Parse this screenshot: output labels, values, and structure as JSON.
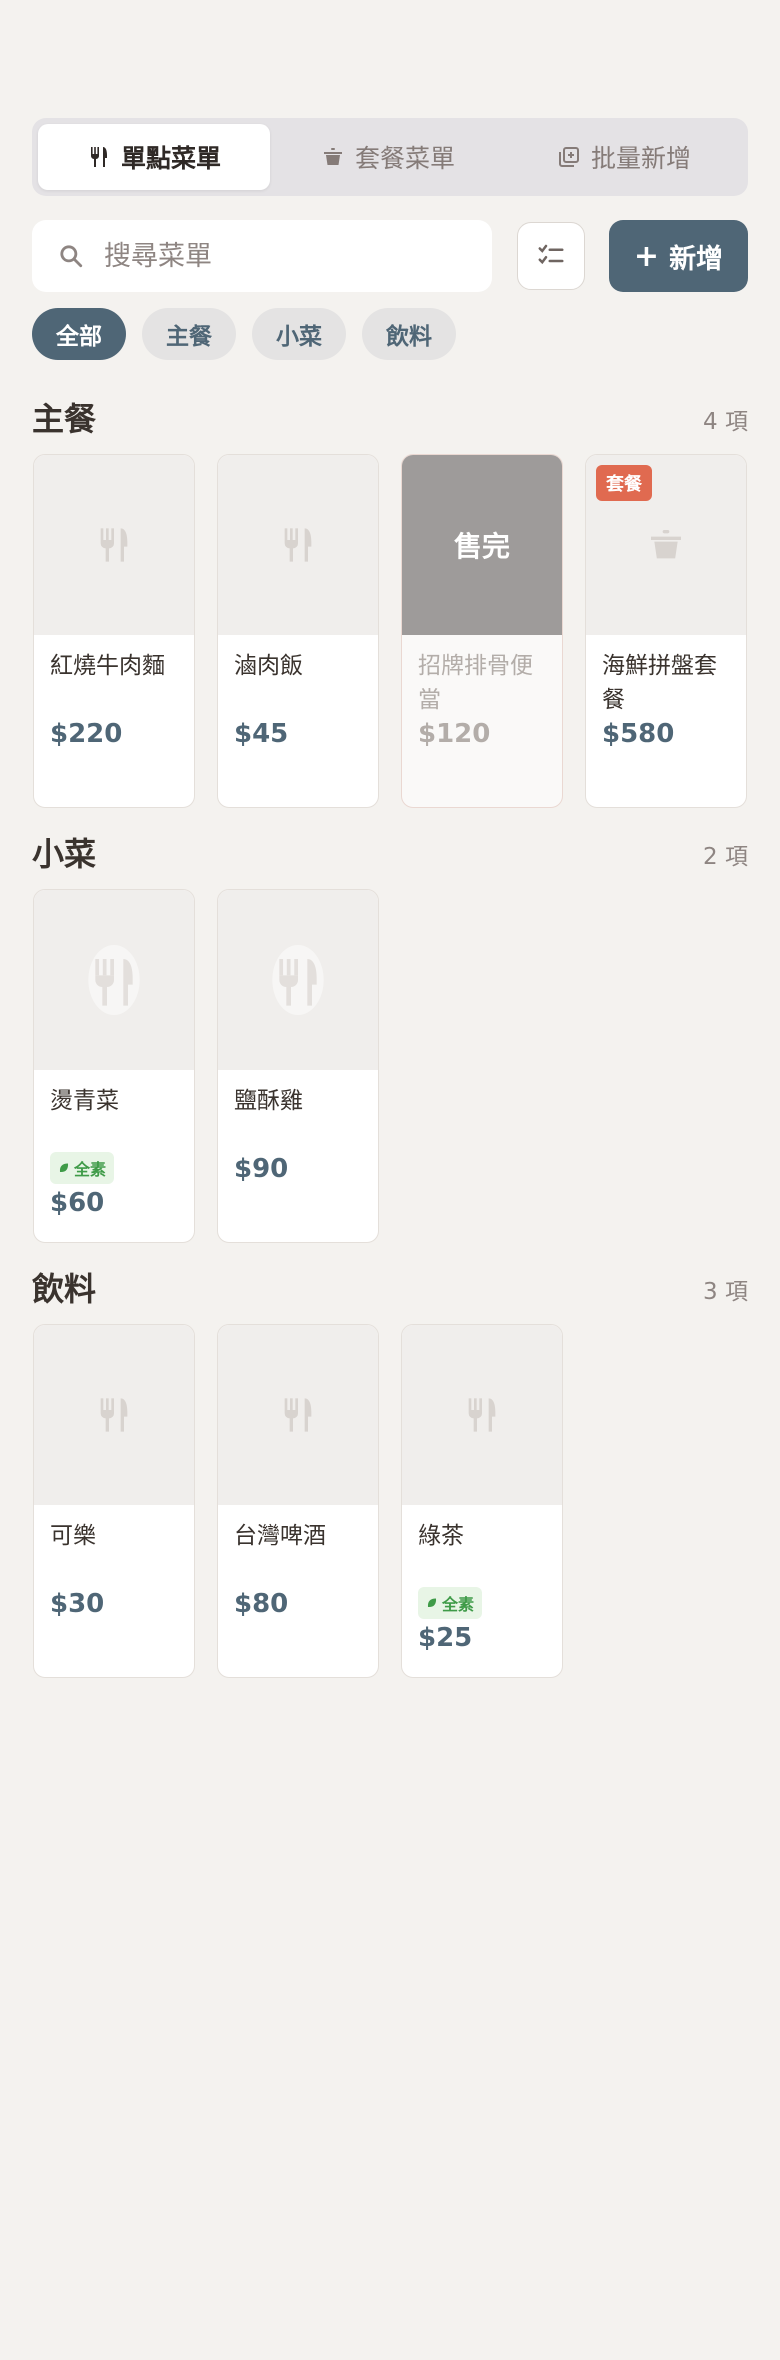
{
  "tabs": [
    {
      "label": "單點菜單",
      "icon": "utensils-icon",
      "active": true
    },
    {
      "label": "套餐菜單",
      "icon": "pot-icon",
      "active": false
    },
    {
      "label": "批量新增",
      "icon": "copy-add-icon",
      "active": false
    }
  ],
  "search": {
    "placeholder": "搜尋菜單",
    "value": ""
  },
  "add_button": {
    "label": "新增",
    "plus": "+"
  },
  "filters": [
    {
      "label": "全部",
      "active": true
    },
    {
      "label": "主餐",
      "active": false
    },
    {
      "label": "小菜",
      "active": false
    },
    {
      "label": "飲料",
      "active": false
    }
  ],
  "sections": [
    {
      "title": "主餐",
      "count": "4 項",
      "items": [
        {
          "name": "紅燒牛肉麵",
          "price": "$220",
          "icon": "utensils-icon"
        },
        {
          "name": "滷肉飯",
          "price": "$45",
          "icon": "utensils-icon"
        },
        {
          "name": "招牌排骨便當",
          "price": "$120",
          "status": "售完"
        },
        {
          "name": "海鮮拼盤套餐",
          "price": "$580",
          "badge": "套餐",
          "icon": "pot-icon"
        }
      ]
    },
    {
      "title": "小菜",
      "count": "2 項",
      "items": [
        {
          "name": "燙青菜",
          "price": "$60",
          "tag": "全素",
          "icon": "utensils-icon"
        },
        {
          "name": "鹽酥雞",
          "price": "$90",
          "icon": "utensils-icon"
        }
      ]
    },
    {
      "title": "飲料",
      "count": "3 項",
      "items": [
        {
          "name": "可樂",
          "price": "$30",
          "icon": "utensils-icon"
        },
        {
          "name": "台灣啤酒",
          "price": "$80",
          "icon": "utensils-icon"
        },
        {
          "name": "綠茶",
          "price": "$25",
          "tag": "全素",
          "icon": "utensils-icon"
        }
      ]
    }
  ],
  "colors": {
    "accent": "#4f6676",
    "badge": "#e06a50",
    "veg": "#3f9b48",
    "background": "#f4f2ef"
  }
}
